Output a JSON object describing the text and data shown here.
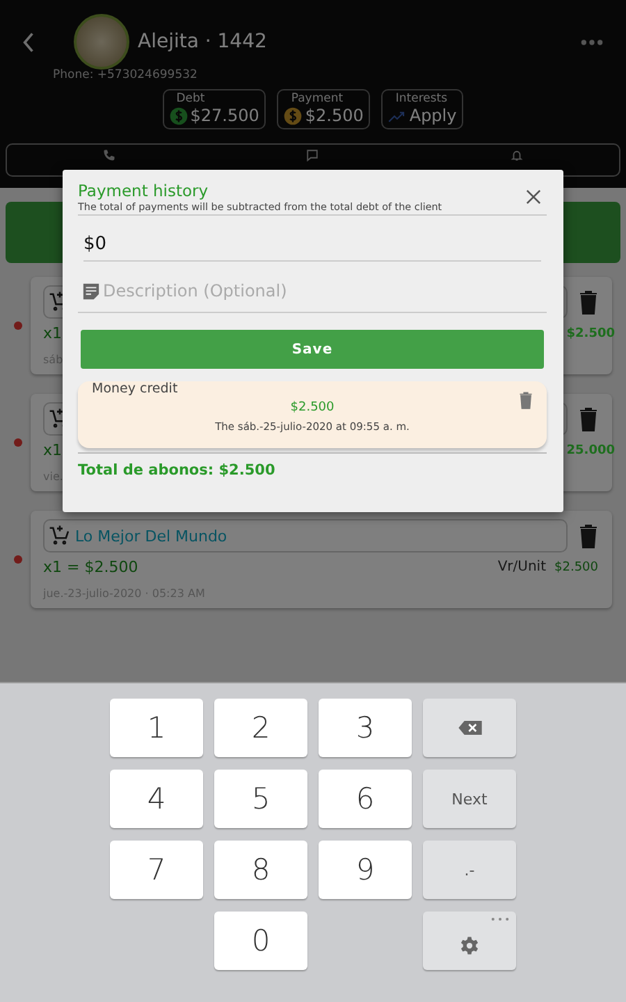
{
  "header": {
    "title": "Alejita · 1442",
    "phone": "Phone: +573024699532",
    "stats": [
      {
        "kind": "debt",
        "label": "Debt",
        "value": "$27.500"
      },
      {
        "kind": "payment",
        "label": "Payment",
        "value": "$2.500"
      },
      {
        "kind": "interests",
        "label": "Interests",
        "value": "Apply"
      }
    ]
  },
  "items": [
    {
      "line": "x1",
      "unit_price": "$2.500",
      "date": "sáb"
    },
    {
      "line": "x1",
      "unit_price": "25.000",
      "date": "vie."
    },
    {
      "title": "Lo Mejor Del Mundo",
      "line": "x1 = $2.500",
      "unit_label": "Vr/Unit",
      "unit_price": "$2.500",
      "date": "jue.-23-julio-2020 · 05:23 AM"
    }
  ],
  "dialog": {
    "title": "Payment history",
    "subtitle": "The total of payments will be subtracted from the total debt of the client",
    "amount": "$0",
    "description": {
      "placeholder": "Description (Optional)"
    },
    "save": "Save",
    "payments": [
      {
        "label": "Money credit",
        "amount": "$2.500",
        "date": "The sáb.-25-julio-2020 at 09:55 a. m."
      }
    ],
    "total": "Total de abonos: $2.500"
  },
  "keyboard": {
    "keys": [
      {
        "kind": "digit",
        "label": "1"
      },
      {
        "kind": "digit",
        "label": "2"
      },
      {
        "kind": "digit",
        "label": "3"
      },
      {
        "kind": "backspace"
      },
      {
        "kind": "digit",
        "label": "4"
      },
      {
        "kind": "digit",
        "label": "5"
      },
      {
        "kind": "digit",
        "label": "6"
      },
      {
        "kind": "action",
        "label": "Next"
      },
      {
        "kind": "digit",
        "label": "7"
      },
      {
        "kind": "digit",
        "label": "8"
      },
      {
        "kind": "digit",
        "label": "9"
      },
      {
        "kind": "action",
        "label": ".-"
      },
      {
        "kind": "blank"
      },
      {
        "kind": "digit",
        "label": "0"
      },
      {
        "kind": "blank"
      },
      {
        "kind": "settings"
      }
    ]
  }
}
